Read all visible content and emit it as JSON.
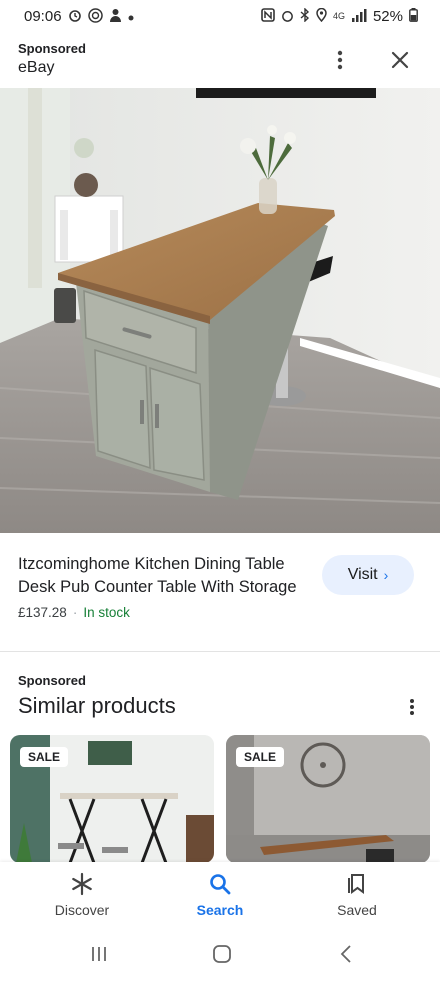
{
  "status_bar": {
    "time": "09:06",
    "network": "4G",
    "battery": "52%"
  },
  "ad": {
    "sponsored_label": "Sponsored",
    "advertiser": "eBay",
    "title": "Itzcominghome Kitchen Dining Table Desk Pub Counter Table With Storage",
    "price": "£137.28",
    "separator": "·",
    "availability": "In stock",
    "visit_label": "Visit",
    "visit_chevron": "›"
  },
  "similar": {
    "sponsored_label": "Sponsored",
    "heading": "Similar products",
    "cards": [
      {
        "badge": "SALE"
      },
      {
        "badge": "SALE"
      }
    ]
  },
  "bottom_nav": {
    "items": [
      {
        "label": "Discover",
        "icon": "asterisk-icon"
      },
      {
        "label": "Search",
        "icon": "search-icon",
        "active": true
      },
      {
        "label": "Saved",
        "icon": "bookmark-icon"
      }
    ]
  },
  "colors": {
    "accent": "#1a73e8",
    "in_stock": "#188038",
    "visit_bg": "#e8f0fe"
  }
}
